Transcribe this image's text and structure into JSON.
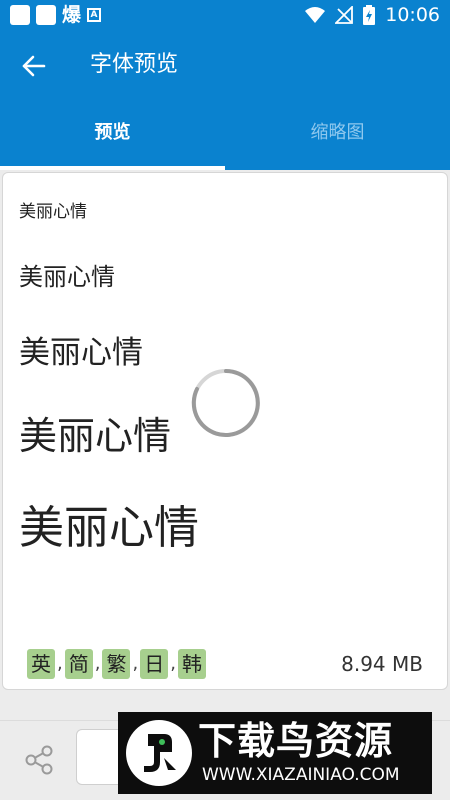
{
  "status_bar": {
    "notification_glyph": "爆",
    "time": "10:06"
  },
  "app_bar": {
    "title": "字体预览"
  },
  "tabs": [
    {
      "label": "预览"
    },
    {
      "label": "缩略图"
    }
  ],
  "preview": {
    "samples": [
      "美丽心情",
      "美丽心情",
      "美丽心情",
      "美丽心情",
      "美丽心情"
    ],
    "languages": [
      "英",
      "简",
      "繁",
      "日",
      "韩"
    ],
    "separator": ",",
    "file_size": "8.94 MB"
  },
  "watermark": {
    "title": "下载鸟资源",
    "url": "WWW.XIAZAINIAO.COM"
  },
  "colors": {
    "primary": "#0a82cf",
    "inactive_tab": "#8fc8ee",
    "language_tag": "#a7cf8e"
  }
}
